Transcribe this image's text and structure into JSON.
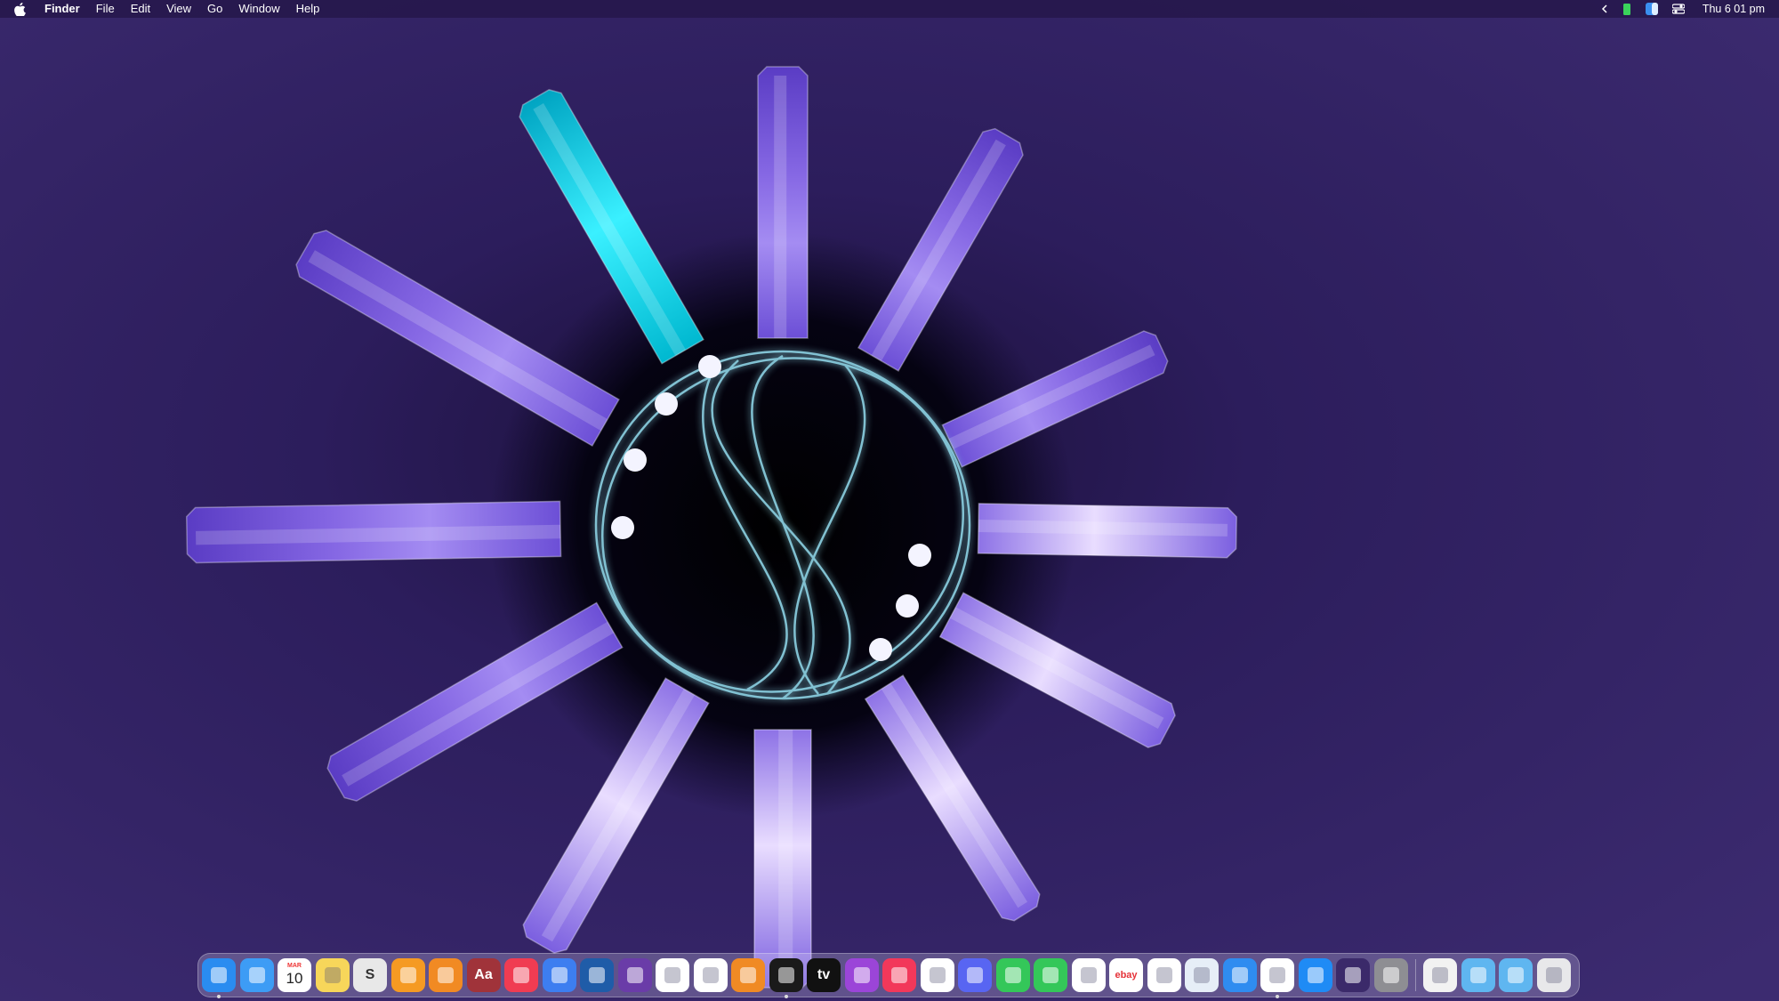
{
  "menubar": {
    "app_name": "Finder",
    "menus": [
      "File",
      "Edit",
      "View",
      "Go",
      "Window",
      "Help"
    ],
    "clock": "Thu 6 01 pm",
    "status_icons": [
      "chevron-left-icon",
      "battery-icon",
      "finder-face-icon",
      "control-center-icon"
    ]
  },
  "dock": {
    "apps": [
      {
        "name": "finder",
        "color": "#2a8cf0",
        "running": true
      },
      {
        "name": "mail",
        "color": "#3d9cf5"
      },
      {
        "name": "calendar",
        "color": "#ffffff",
        "month": "MAR",
        "day": "10"
      },
      {
        "name": "notes",
        "color": "#f7d65a"
      },
      {
        "name": "scrivener",
        "color": "#e8e8e8",
        "glyph": "S"
      },
      {
        "name": "pages",
        "color": "#f59a23"
      },
      {
        "name": "books",
        "color": "#f18a23"
      },
      {
        "name": "dictionary",
        "color": "#a0333a",
        "glyph": "Aa"
      },
      {
        "name": "news",
        "color": "#f03c52"
      },
      {
        "name": "reddit-app",
        "color": "#3d7ef0"
      },
      {
        "name": "affinity-designer",
        "color": "#1f5ca8"
      },
      {
        "name": "affinity-photo",
        "color": "#6a3ca8"
      },
      {
        "name": "pixelmator",
        "color": "#ffffff"
      },
      {
        "name": "photos",
        "color": "#ffffff"
      },
      {
        "name": "blender",
        "color": "#f08a24"
      },
      {
        "name": "voice-memos",
        "color": "#1a1a1a",
        "running": true
      },
      {
        "name": "apple-tv",
        "color": "#111111",
        "glyph": "tv"
      },
      {
        "name": "podcasts",
        "color": "#9b45d8"
      },
      {
        "name": "music",
        "color": "#f2385a"
      },
      {
        "name": "sims",
        "color": "#ffffff"
      },
      {
        "name": "discord",
        "color": "#5865f2"
      },
      {
        "name": "messages",
        "color": "#34c759"
      },
      {
        "name": "facetime",
        "color": "#34c759"
      },
      {
        "name": "messenger",
        "color": "#ffffff"
      },
      {
        "name": "ebay",
        "color": "#ffffff",
        "glyph": "ebay"
      },
      {
        "name": "home",
        "color": "#ffffff"
      },
      {
        "name": "preview",
        "color": "#e6eef7"
      },
      {
        "name": "safari",
        "color": "#2f8cf0"
      },
      {
        "name": "chrome",
        "color": "#ffffff",
        "running": true
      },
      {
        "name": "app-store",
        "color": "#1f8bf5"
      },
      {
        "name": "siri",
        "color": "#3b2a6a"
      },
      {
        "name": "system-settings",
        "color": "#8e8e93"
      }
    ],
    "folders": [
      {
        "name": "home-folder",
        "color": "#f2f2f2"
      },
      {
        "name": "folder",
        "color": "#5fb6f0"
      },
      {
        "name": "downloads-folder",
        "color": "#5fb6f0"
      },
      {
        "name": "trash",
        "color": "#e8e8ea"
      }
    ]
  }
}
